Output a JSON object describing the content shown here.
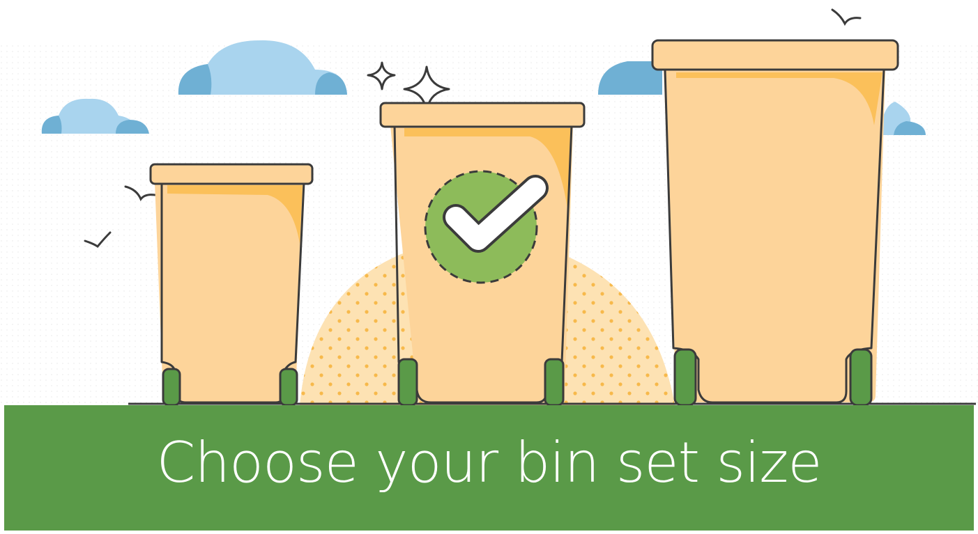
{
  "banner": {
    "title": "Choose your bin set size",
    "color": "#5a9a48",
    "text_color": "#ffffff"
  },
  "illustration": {
    "bins": [
      {
        "size": "small",
        "selected": false
      },
      {
        "size": "medium",
        "selected": true
      },
      {
        "size": "large",
        "selected": false
      }
    ],
    "selected_icon": "checkmark-icon",
    "decorations": [
      "cloud-icon",
      "bird-icon",
      "sparkle-icon"
    ],
    "colors": {
      "bin_body": "#fdd49a",
      "bin_highlight": "#fbc05a",
      "wheel": "#5a9a48",
      "outline": "#3b3b3b",
      "check_circle": "#8dbb5a",
      "cloud": "#a9d4ee",
      "cloud_shadow": "#6fb0d4",
      "sun_mound": "#fde2b3"
    }
  }
}
